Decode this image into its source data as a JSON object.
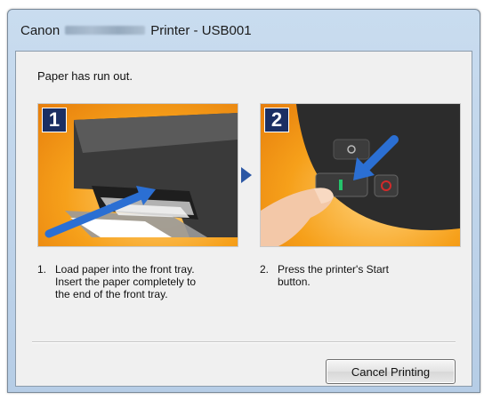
{
  "window": {
    "title_prefix": "Canon",
    "title_suffix": "Printer - USB001"
  },
  "message": "Paper has run out.",
  "steps": [
    {
      "badge": "1",
      "number": "1.",
      "text": "Load paper into the front tray.\nInsert the paper completely to\nthe end of the front tray."
    },
    {
      "badge": "2",
      "number": "2.",
      "text": "Press the printer's Start\nbutton."
    }
  ],
  "buttons": {
    "cancel": "Cancel Printing"
  },
  "icons": {
    "step_arrow": "triangle-right-icon",
    "start_button": "start-button-icon"
  },
  "colors": {
    "panel_background": "#f6a01a",
    "badge": "#1b2f63",
    "arrow": "#2b57a4"
  }
}
